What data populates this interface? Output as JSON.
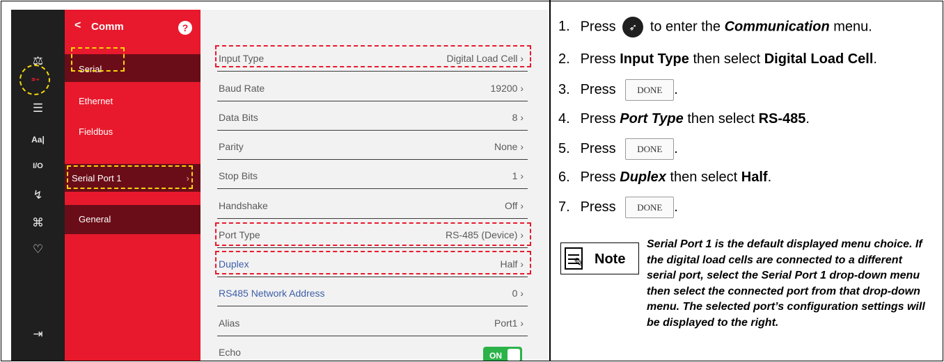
{
  "screen": {
    "iconbar": [
      {
        "icon": "scale-icon",
        "glyph": "⚖"
      },
      {
        "icon": "communication-icon",
        "glyph": "➶"
      },
      {
        "icon": "list-icon",
        "glyph": "☰"
      },
      {
        "icon": "text-format-icon",
        "glyph": "Aa|"
      },
      {
        "icon": "io-icon",
        "glyph": "I/O"
      },
      {
        "icon": "calibration-icon",
        "glyph": "↯"
      },
      {
        "icon": "network-icon",
        "glyph": "⌘"
      },
      {
        "icon": "diagnostics-heart-icon",
        "glyph": "♡"
      },
      {
        "icon": "exit-icon",
        "glyph": "⇥"
      }
    ],
    "menu": {
      "back_glyph": "<",
      "title": "Comm",
      "help_glyph": "?",
      "items": [
        "Serial",
        "Ethernet",
        "Fieldbus",
        "Serial Port 1",
        "General"
      ],
      "dropdown_glyph": "›"
    },
    "settings": [
      {
        "label": "Input Type",
        "value": "Digital Load Cell ›"
      },
      {
        "label": "Baud Rate",
        "value": "19200 ›"
      },
      {
        "label": "Data Bits",
        "value": "8 ›"
      },
      {
        "label": "Parity",
        "value": "None ›"
      },
      {
        "label": "Stop Bits",
        "value": "1 ›"
      },
      {
        "label": "Handshake",
        "value": "Off ›"
      },
      {
        "label": "Port Type",
        "value": "RS-485 (Device) ›"
      },
      {
        "label": "Duplex",
        "value": "Half ›"
      },
      {
        "label": "RS485 Network Address",
        "value": "0 ›"
      },
      {
        "label": "Alias",
        "value": "Port1 ›"
      },
      {
        "label": "Echo",
        "toggle": "ON"
      }
    ]
  },
  "instructions": {
    "step1": {
      "num": "1.",
      "pre": "Press",
      "post": "to enter the",
      "bold": "Communication",
      "end": "menu."
    },
    "step2": {
      "num": "2.",
      "pre": "Press",
      "bold1": "Input Type",
      "mid": "then select",
      "bold2": "Digital Load Cell",
      "end": "."
    },
    "step3": {
      "num": "3.",
      "pre": "Press",
      "button": "DONE",
      "end": "."
    },
    "step4": {
      "num": "4.",
      "pre": "Press",
      "bold1": "Port Type",
      "mid": "then select",
      "bold2": "RS-485",
      "end": "."
    },
    "step5": {
      "num": "5.",
      "pre": "Press",
      "button": "DONE",
      "end": "."
    },
    "step6": {
      "num": "6.",
      "pre": "Press",
      "bold1": "Duplex",
      "mid": "then select",
      "bold2": "Half",
      "end": "."
    },
    "step7": {
      "num": "7.",
      "pre": "Press",
      "button": "DONE",
      "end": "."
    },
    "note_label": "Note",
    "note_text": "Serial Port 1 is the default displayed menu choice. If the digital load cells are connected to a different serial port, select the Serial Port 1 drop-down menu then select the connected port from that drop-down menu. The selected port’s configuration settings will be displayed to the right."
  },
  "colors": {
    "accent_red": "#e8192c",
    "highlight_yellow": "#f5d60b",
    "toggle_green": "#2bb34a"
  }
}
